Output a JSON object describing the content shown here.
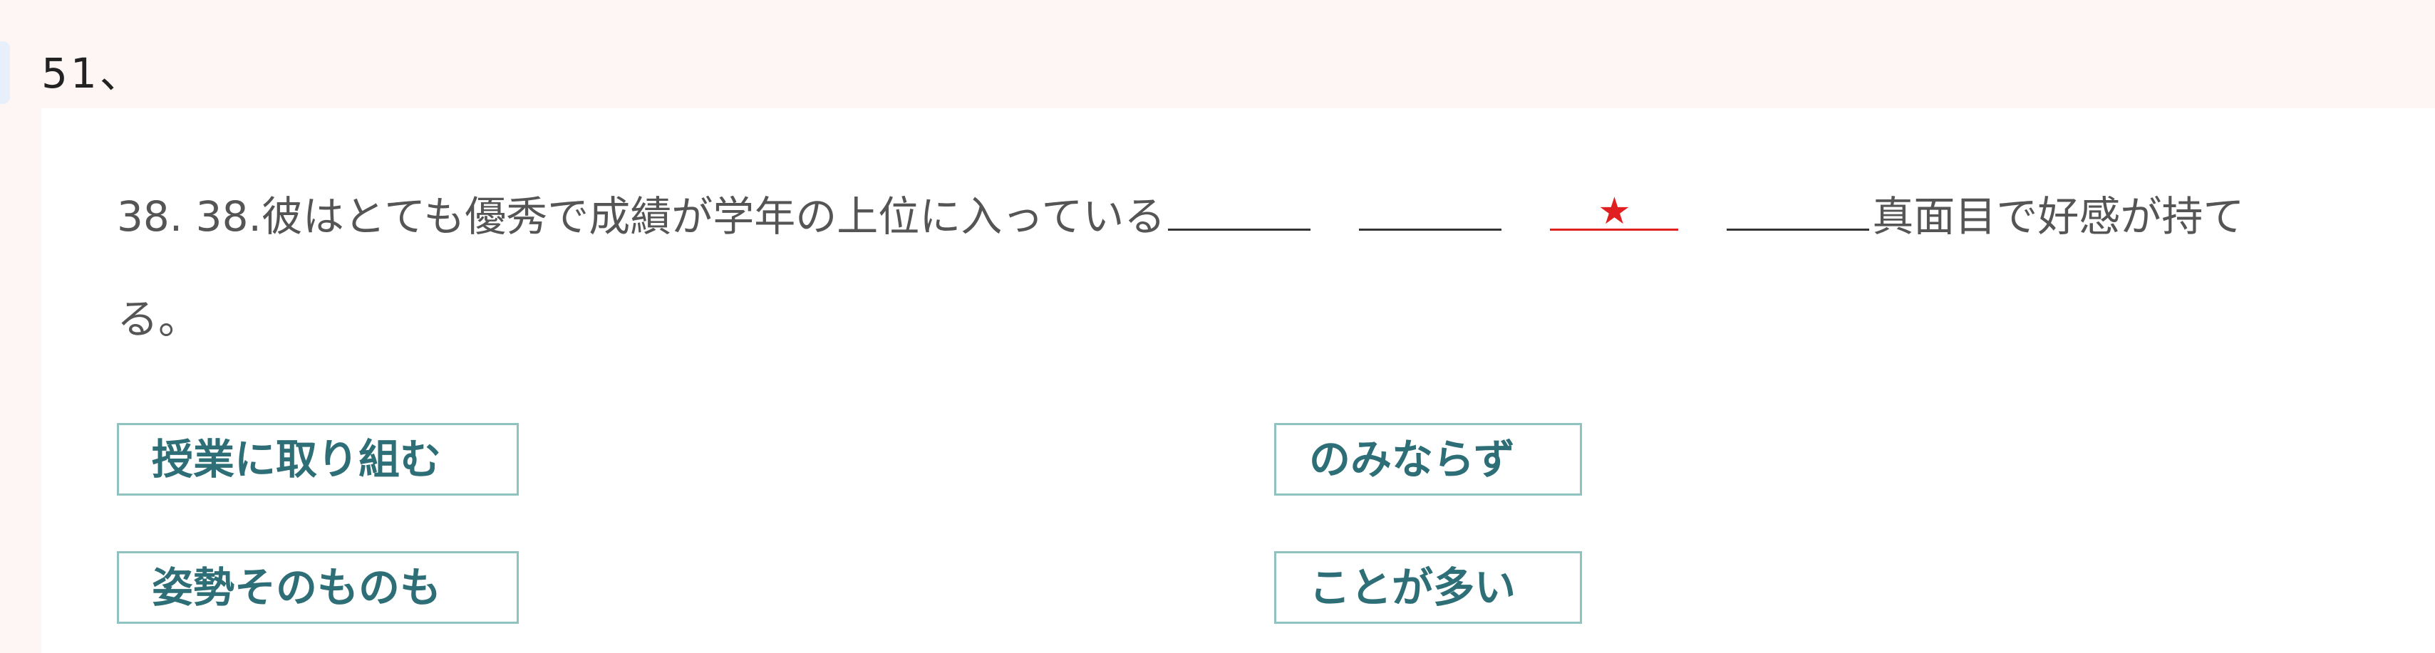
{
  "header": {
    "question_number": "51、"
  },
  "question": {
    "text_before": "38. 38.彼はとても優秀で成績が学年の上位に入っている",
    "star_symbol": "★",
    "text_after_line1": "真面目で好感が持て",
    "text_line2": "る。",
    "star_color": "#e02020"
  },
  "options": [
    {
      "label": "授業に取り組む"
    },
    {
      "label": "のみならず"
    },
    {
      "label": "姿勢そのものも"
    },
    {
      "label": "ことが多い"
    }
  ],
  "colors": {
    "page_background": "#fdf6f5",
    "card_background": "#ffffff",
    "option_border": "#8fc3c0",
    "option_text": "#2e6f77"
  }
}
